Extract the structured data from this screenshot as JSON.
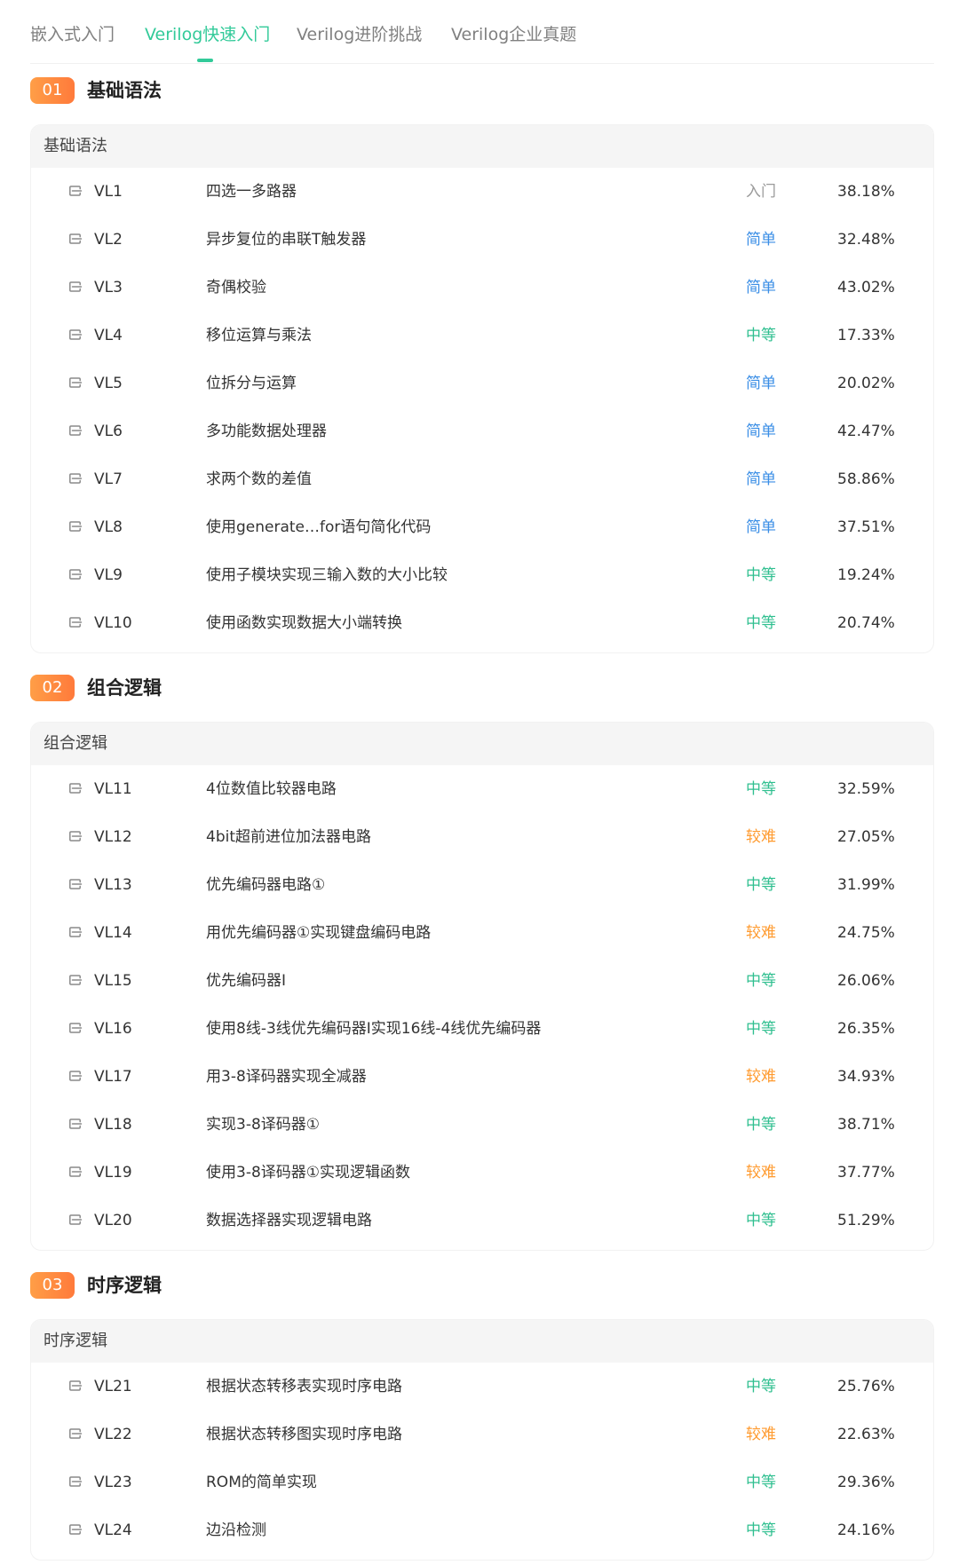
{
  "tabs": [
    {
      "label": "嵌入式入门"
    },
    {
      "label": "Verilog快速入门",
      "active": true
    },
    {
      "label": "Verilog进阶挑战"
    },
    {
      "label": "Verilog企业真题"
    }
  ],
  "colors": {
    "accent": "#32ca99",
    "section_badge": "#ff8a3d",
    "diff_rumen": "#9a9a9a",
    "diff_jiandan": "#3a8ee6",
    "diff_zhongdeng": "#2fbf8f",
    "diff_jiaonan": "#ff9a2e"
  },
  "sections": [
    {
      "num": "01",
      "title": "基础语法",
      "card_title": "基础语法",
      "problems": [
        {
          "code": "VL1",
          "name": "四选一多路器",
          "difficulty": "入门",
          "rate": "38.18%"
        },
        {
          "code": "VL2",
          "name": "异步复位的串联T触发器",
          "difficulty": "简单",
          "rate": "32.48%"
        },
        {
          "code": "VL3",
          "name": "奇偶校验",
          "difficulty": "简单",
          "rate": "43.02%"
        },
        {
          "code": "VL4",
          "name": "移位运算与乘法",
          "difficulty": "中等",
          "rate": "17.33%"
        },
        {
          "code": "VL5",
          "name": "位拆分与运算",
          "difficulty": "简单",
          "rate": "20.02%"
        },
        {
          "code": "VL6",
          "name": "多功能数据处理器",
          "difficulty": "简单",
          "rate": "42.47%"
        },
        {
          "code": "VL7",
          "name": "求两个数的差值",
          "difficulty": "简单",
          "rate": "58.86%"
        },
        {
          "code": "VL8",
          "name": "使用generate…for语句简化代码",
          "difficulty": "简单",
          "rate": "37.51%"
        },
        {
          "code": "VL9",
          "name": "使用子模块实现三输入数的大小比较",
          "difficulty": "中等",
          "rate": "19.24%"
        },
        {
          "code": "VL10",
          "name": "使用函数实现数据大小端转换",
          "difficulty": "中等",
          "rate": "20.74%"
        }
      ]
    },
    {
      "num": "02",
      "title": "组合逻辑",
      "card_title": "组合逻辑",
      "problems": [
        {
          "code": "VL11",
          "name": "4位数值比较器电路",
          "difficulty": "中等",
          "rate": "32.59%"
        },
        {
          "code": "VL12",
          "name": "4bit超前进位加法器电路",
          "difficulty": "较难",
          "rate": "27.05%"
        },
        {
          "code": "VL13",
          "name": "优先编码器电路①",
          "difficulty": "中等",
          "rate": "31.99%"
        },
        {
          "code": "VL14",
          "name": "用优先编码器①实现键盘编码电路",
          "difficulty": "较难",
          "rate": "24.75%"
        },
        {
          "code": "VL15",
          "name": "优先编码器Ⅰ",
          "difficulty": "中等",
          "rate": "26.06%"
        },
        {
          "code": "VL16",
          "name": "使用8线-3线优先编码器Ⅰ实现16线-4线优先编码器",
          "difficulty": "中等",
          "rate": "26.35%"
        },
        {
          "code": "VL17",
          "name": "用3-8译码器实现全减器",
          "difficulty": "较难",
          "rate": "34.93%"
        },
        {
          "code": "VL18",
          "name": "实现3-8译码器①",
          "difficulty": "中等",
          "rate": "38.71%"
        },
        {
          "code": "VL19",
          "name": "使用3-8译码器①实现逻辑函数",
          "difficulty": "较难",
          "rate": "37.77%"
        },
        {
          "code": "VL20",
          "name": "数据选择器实现逻辑电路",
          "difficulty": "中等",
          "rate": "51.29%"
        }
      ]
    },
    {
      "num": "03",
      "title": "时序逻辑",
      "card_title": "时序逻辑",
      "problems": [
        {
          "code": "VL21",
          "name": "根据状态转移表实现时序电路",
          "difficulty": "中等",
          "rate": "25.76%"
        },
        {
          "code": "VL22",
          "name": "根据状态转移图实现时序电路",
          "difficulty": "较难",
          "rate": "22.63%"
        },
        {
          "code": "VL23",
          "name": "ROM的简单实现",
          "difficulty": "中等",
          "rate": "29.36%"
        },
        {
          "code": "VL24",
          "name": "边沿检测",
          "difficulty": "中等",
          "rate": "24.16%"
        }
      ]
    }
  ]
}
